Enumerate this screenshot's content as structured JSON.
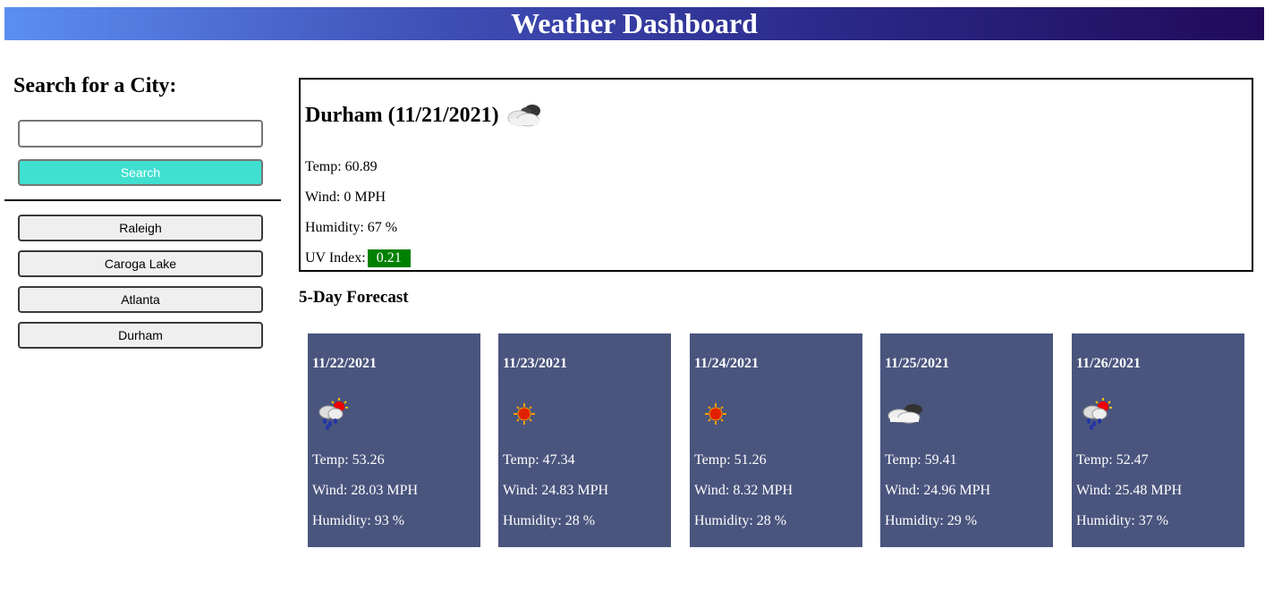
{
  "header": {
    "title": "Weather Dashboard"
  },
  "sidebar": {
    "search_title": "Search for a City:",
    "search_input_value": "",
    "search_button_label": "Search",
    "history": [
      {
        "label": "Raleigh"
      },
      {
        "label": "Caroga Lake"
      },
      {
        "label": "Atlanta"
      },
      {
        "label": "Durham"
      }
    ]
  },
  "current": {
    "title": "Durham (11/21/2021)",
    "icon": "cloud-icon",
    "temp": "Temp: 60.89",
    "wind": "Wind: 0 MPH",
    "humidity": "Humidity: 67 %",
    "uv_label": "UV Index:",
    "uv_value": "0.21",
    "uv_color": "#008000"
  },
  "forecast": {
    "title": "5-Day Forecast",
    "card_color": "#4a557e",
    "days": [
      {
        "date": "11/22/2021",
        "icon": "rain-sun-icon",
        "temp": "Temp: 53.26",
        "wind": "Wind: 28.03 MPH",
        "humidity": "Humidity: 93 %"
      },
      {
        "date": "11/23/2021",
        "icon": "sun-icon",
        "temp": "Temp: 47.34",
        "wind": "Wind: 24.83 MPH",
        "humidity": "Humidity: 28 %"
      },
      {
        "date": "11/24/2021",
        "icon": "sun-icon",
        "temp": "Temp: 51.26",
        "wind": "Wind: 8.32 MPH",
        "humidity": "Humidity: 28 %"
      },
      {
        "date": "11/25/2021",
        "icon": "cloud-icon",
        "temp": "Temp: 59.41",
        "wind": "Wind: 24.96 MPH",
        "humidity": "Humidity: 29 %"
      },
      {
        "date": "11/26/2021",
        "icon": "rain-sun-icon",
        "temp": "Temp: 52.47",
        "wind": "Wind: 25.48 MPH",
        "humidity": "Humidity: 37 %"
      }
    ]
  }
}
